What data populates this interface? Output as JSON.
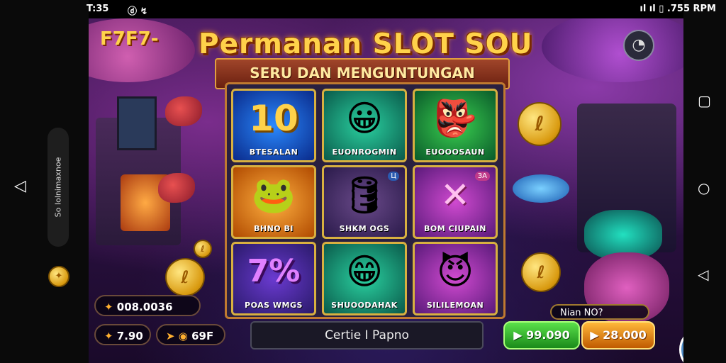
{
  "status": {
    "time": "T:35",
    "icons_left": "ⓓ ↯",
    "right": "ıl ıl ▯ .755 RPM"
  },
  "game": {
    "brand": "F7F7-",
    "title": "Permanan SLOT SOU",
    "subtitle": "SERU DAN MENGUNTUNGAN",
    "tiles": [
      {
        "art": "10",
        "label": "BTESALAN"
      },
      {
        "art": "😀",
        "label": "EUONROGMIN"
      },
      {
        "art": "👺",
        "label": "EUOOOSAUN"
      },
      {
        "art": "🐸",
        "label": "BHNO BI"
      },
      {
        "art": "🛢",
        "label": "SHKM OGS"
      },
      {
        "art": "✕",
        "label": "BOM CIUPAIN"
      },
      {
        "art": "7%",
        "label": "POAS WMGS"
      },
      {
        "art": "😁",
        "label": "SHUOODAHAK"
      },
      {
        "art": "😈",
        "label": "SILILEMOAN"
      }
    ],
    "tile_badges": {
      "wood": "Ц",
      "purple": "ЗА"
    },
    "balance": "008.0036",
    "bet_left": "7.90",
    "bet_right": "69F",
    "center_bar": "Certie I Papno",
    "nian": "Nian NO?",
    "green_button": "99.090",
    "orange_button": "28.000",
    "coin_glyph": "ℓ"
  },
  "side": {
    "vertical_text": "So Iolnimaxnoe"
  },
  "colors": {
    "accent_gold": "#ffd24a",
    "green": "#3ac03a",
    "orange": "#ff9a20"
  }
}
